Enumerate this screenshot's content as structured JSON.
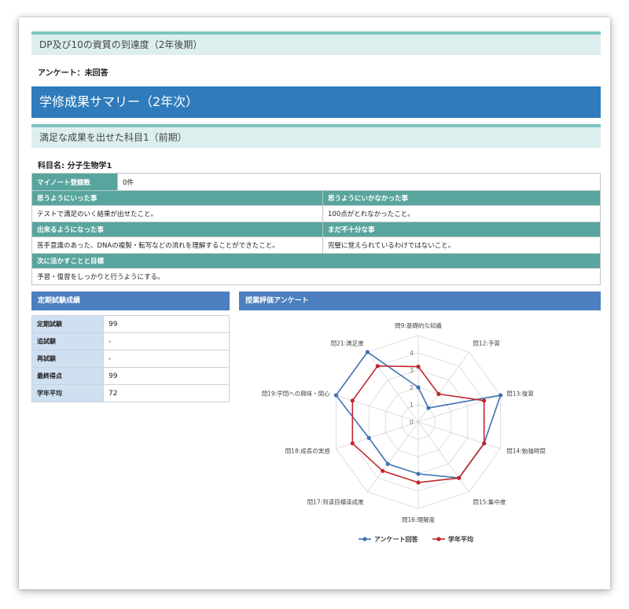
{
  "header": {
    "dp_title": "DP及び10の資質の到達度（2年後期）",
    "survey_status": "アンケート：未回答",
    "summary_title": "学修成果サマリー（2年次）",
    "subject_section_title": "満足な成果を出せた科目1（前期）",
    "subject_name": "科目名:  分子生物学1"
  },
  "subject_table": {
    "mynote_label": "マイノート登録数",
    "mynote_value": "0件",
    "went_well_label": "思うようにいった事",
    "went_well_value": "テストで満足のいく結果が出せたこと。",
    "not_well_label": "思うようにいかなかった事",
    "not_well_value": "100点がとれなかったこと。",
    "achieved_label": "出来るようになった事",
    "achieved_value": "苦手意識のあった、DNAの複製・転写などの流れを理解することができたこと。",
    "insufficient_label": "まだ不十分な事",
    "insufficient_value": "完璧に覚えられているわけではないこと。",
    "next_label": "次に活かすことと目標",
    "next_value": "予習・復習をしっかりと行うようにする。"
  },
  "exam": {
    "title": "定期試験成績",
    "rows": [
      {
        "label": "定期試験",
        "value": "99"
      },
      {
        "label": "追試験",
        "value": "-"
      },
      {
        "label": "再試験",
        "value": "-"
      },
      {
        "label": "最終得点",
        "value": "99"
      },
      {
        "label": "学年平均",
        "value": "72"
      }
    ]
  },
  "evaluation": {
    "title": "授業評価アンケート"
  },
  "chart_data": {
    "type": "radar",
    "categories": [
      "問9:基礎的な知識",
      "問12:予習",
      "問13:復習",
      "問14:勉強時間",
      "問15:集中度",
      "問16:理解度",
      "問17:到達目標達成度",
      "問18:成長の実感",
      "問19:学問への興味・関心",
      "問21:満足度"
    ],
    "ticks": [
      0,
      1,
      2,
      3,
      4
    ],
    "rlim": [
      0,
      5
    ],
    "series": [
      {
        "name": "アンケート回答",
        "color": "#3f73b4",
        "values": [
          2,
          1,
          5,
          4,
          4,
          3,
          3,
          3,
          5,
          5
        ]
      },
      {
        "name": "学年平均",
        "color": "#c0272d",
        "values": [
          3.2,
          2,
          4,
          4,
          4,
          3.5,
          3.5,
          4,
          4,
          4
        ]
      }
    ],
    "legend_position": "bottom"
  }
}
